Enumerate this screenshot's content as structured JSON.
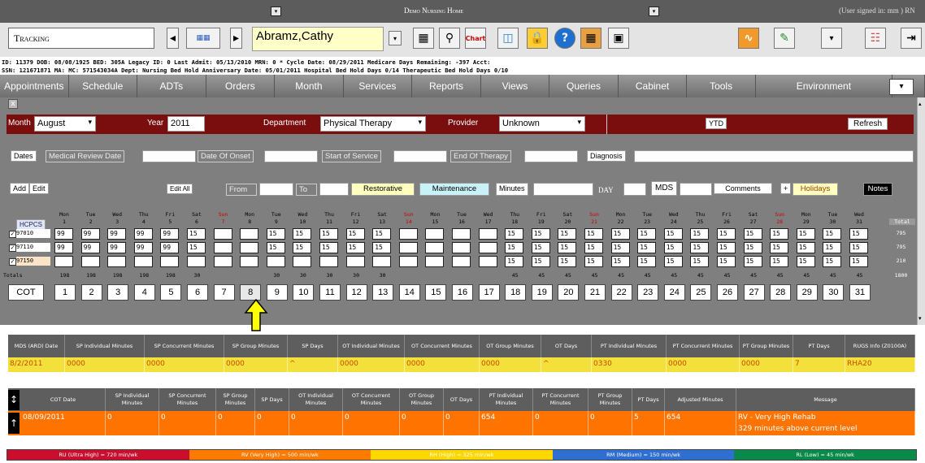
{
  "app": {
    "title": "Demo Nursing Home",
    "user_status": "(User signed in: mm ) RN"
  },
  "toolbar": {
    "module": "Tracking",
    "patient_name": "Abramz,Cathy",
    "chart_label": "Chart"
  },
  "info": {
    "line1": "ID: 11379 DOB: 08/08/1925 BED: 305A Legacy ID: 0 Last Admit: 05/13/2010 MRN: 0 * Cycle Date: 08/29/2011 Medicare Days Remaining: -397 Acct:",
    "line2": "SSN: 121671871 MA:            MC: 571543034A Dept: Nursing Bed Hold Anniversary Date: 05/01/2011 Hospital Bed Hold Days 0/14 Therapeutic Bed Hold Days 0/10"
  },
  "nav": [
    "Appointments",
    "Schedule",
    "ADTs",
    "Orders",
    "Month",
    "Services",
    "Reports",
    "Views",
    "Queries",
    "Cabinet",
    "Tools",
    "Environment"
  ],
  "filters": {
    "month_label": "Month",
    "month_value": "August",
    "year_label": "Year",
    "year_value": "2011",
    "department_label": "Department",
    "department_value": "Physical Therapy",
    "provider_label": "Provider",
    "provider_value": "Unknown",
    "ytd_label": "YTD",
    "refresh_label": "Refresh"
  },
  "dates_row": {
    "dates": "Dates",
    "medical_review": "Medical Review Date",
    "onset": "Date Of Onset",
    "start_service": "Start of Service",
    "end_therapy": "End Of Therapy",
    "diagnosis": "Diagnosis"
  },
  "controls": {
    "add": "Add",
    "edit": "Edit",
    "edit_all": "Edit All",
    "from": "From",
    "to": "To",
    "restorative": "Restorative",
    "maintenance": "Maintenance",
    "minutes": "Minutes",
    "day": "DAY",
    "mds": "MDS",
    "comments": "Comments",
    "plus": "+",
    "holidays": "Holidays",
    "notes": "Notes"
  },
  "calendar": {
    "hcpcs_label": "HCPCS",
    "total_label": "Total",
    "totals_label": "Totals",
    "cot_label": "COT",
    "days": [
      {
        "dow": "Mon",
        "d": "1"
      },
      {
        "dow": "Tue",
        "d": "2"
      },
      {
        "dow": "Wed",
        "d": "3"
      },
      {
        "dow": "Thu",
        "d": "4"
      },
      {
        "dow": "Fri",
        "d": "5"
      },
      {
        "dow": "Sat",
        "d": "6"
      },
      {
        "dow": "Sun",
        "d": "7"
      },
      {
        "dow": "Mon",
        "d": "8"
      },
      {
        "dow": "Tue",
        "d": "9"
      },
      {
        "dow": "Wed",
        "d": "10"
      },
      {
        "dow": "Thu",
        "d": "11"
      },
      {
        "dow": "Fri",
        "d": "12"
      },
      {
        "dow": "Sat",
        "d": "13"
      },
      {
        "dow": "Sun",
        "d": "14"
      },
      {
        "dow": "Mon",
        "d": "15"
      },
      {
        "dow": "Tue",
        "d": "16"
      },
      {
        "dow": "Wed",
        "d": "17"
      },
      {
        "dow": "Thu",
        "d": "18"
      },
      {
        "dow": "Fri",
        "d": "19"
      },
      {
        "dow": "Sat",
        "d": "20"
      },
      {
        "dow": "Sun",
        "d": "21"
      },
      {
        "dow": "Mon",
        "d": "22"
      },
      {
        "dow": "Tue",
        "d": "23"
      },
      {
        "dow": "Wed",
        "d": "24"
      },
      {
        "dow": "Thu",
        "d": "25"
      },
      {
        "dow": "Fri",
        "d": "26"
      },
      {
        "dow": "Sat",
        "d": "27"
      },
      {
        "dow": "Sun",
        "d": "28"
      },
      {
        "dow": "Mon",
        "d": "29"
      },
      {
        "dow": "Tue",
        "d": "30"
      },
      {
        "dow": "Wed",
        "d": "31"
      }
    ],
    "rows": [
      {
        "code": "97010",
        "total": "795",
        "vals": [
          "99",
          "99",
          "99",
          "99",
          "99",
          "15",
          "",
          "",
          "15",
          "15",
          "15",
          "15",
          "15",
          "",
          "",
          "",
          "",
          "15",
          "15",
          "15",
          "15",
          "15",
          "15",
          "15",
          "15",
          "15",
          "15",
          "15",
          "15",
          "15",
          "15"
        ]
      },
      {
        "code": "97110",
        "total": "795",
        "vals": [
          "99",
          "99",
          "99",
          "99",
          "99",
          "15",
          "",
          "",
          "15",
          "15",
          "15",
          "15",
          "15",
          "",
          "",
          "",
          "",
          "15",
          "15",
          "15",
          "15",
          "15",
          "15",
          "15",
          "15",
          "15",
          "15",
          "15",
          "15",
          "15",
          "15"
        ]
      },
      {
        "code": "97150",
        "total": "210",
        "vals": [
          "",
          "",
          "",
          "",
          "",
          "",
          "",
          "",
          "",
          "",
          "",
          "",
          "",
          "",
          "",
          "",
          "",
          "15",
          "15",
          "15",
          "15",
          "15",
          "15",
          "15",
          "15",
          "15",
          "15",
          "15",
          "15",
          "15",
          "15"
        ]
      }
    ],
    "totals": [
      "198",
      "198",
      "198",
      "198",
      "198",
      "30",
      "",
      "",
      "30",
      "30",
      "30",
      "30",
      "30",
      "",
      "",
      "",
      "",
      "45",
      "45",
      "45",
      "45",
      "45",
      "45",
      "45",
      "45",
      "45",
      "45",
      "45",
      "45",
      "45",
      "45"
    ],
    "grand_total": "1800"
  },
  "mds_table": {
    "headers": [
      "MDS (ARD) Date",
      "SP Individual Minutes",
      "SP Concurrent Minutes",
      "SP Group Minutes",
      "SP Days",
      "OT Individual Minutes",
      "OT Concurrent Minutes",
      "OT Group Minutes",
      "OT Days",
      "PT Individual Minutes",
      "PT Concurrent Minutes",
      "PT Group Minutes",
      "PT Days",
      "RUGS Info (Z0100A)"
    ],
    "values": [
      "8/2/2011",
      "0000",
      "0000",
      "0000",
      "^",
      "0000",
      "0000",
      "0000",
      "^",
      "0330",
      "0000",
      "0000",
      "7",
      "RHA20"
    ]
  },
  "cot_table": {
    "headers": [
      "COT Date",
      "SP Individual Minutes",
      "SP Concurrent Minutes",
      "SP Group Minutes",
      "SP Days",
      "OT Individual Minutes",
      "OT Concurrent Minutes",
      "OT Group Minutes",
      "OT Days",
      "PT Individual Minutes",
      "PT Concurrent Minutes",
      "PT Group Minutes",
      "PT Days",
      "Adjusted Minutes",
      "Message"
    ],
    "values": [
      "08/09/2011",
      "0",
      "0",
      "0",
      "0",
      "0",
      "0",
      "0",
      "0",
      "654",
      "0",
      "0",
      "5",
      "654",
      ""
    ],
    "message_line1": "RV - Very High Rehab",
    "message_line2": "329 minutes above current level"
  },
  "legend": [
    {
      "label": "RU (Ultra High) = 720 min/wk",
      "color": "#c8102e"
    },
    {
      "label": "RV (Very High) = 500 min/wk",
      "color": "#ff7a00"
    },
    {
      "label": "RH (High) = 325 min/wk",
      "color": "#ffd700"
    },
    {
      "label": "RM (Medium) = 150 min/wk",
      "color": "#2f6fd1"
    },
    {
      "label": "RL (Low) = 45 min/wk",
      "color": "#0a8a4a"
    }
  ],
  "colors": {
    "maroon": "#7a0d0d",
    "mds_row": "#f3e03a",
    "cot_row": "#ff7300",
    "nav": "#7a7a7a"
  }
}
